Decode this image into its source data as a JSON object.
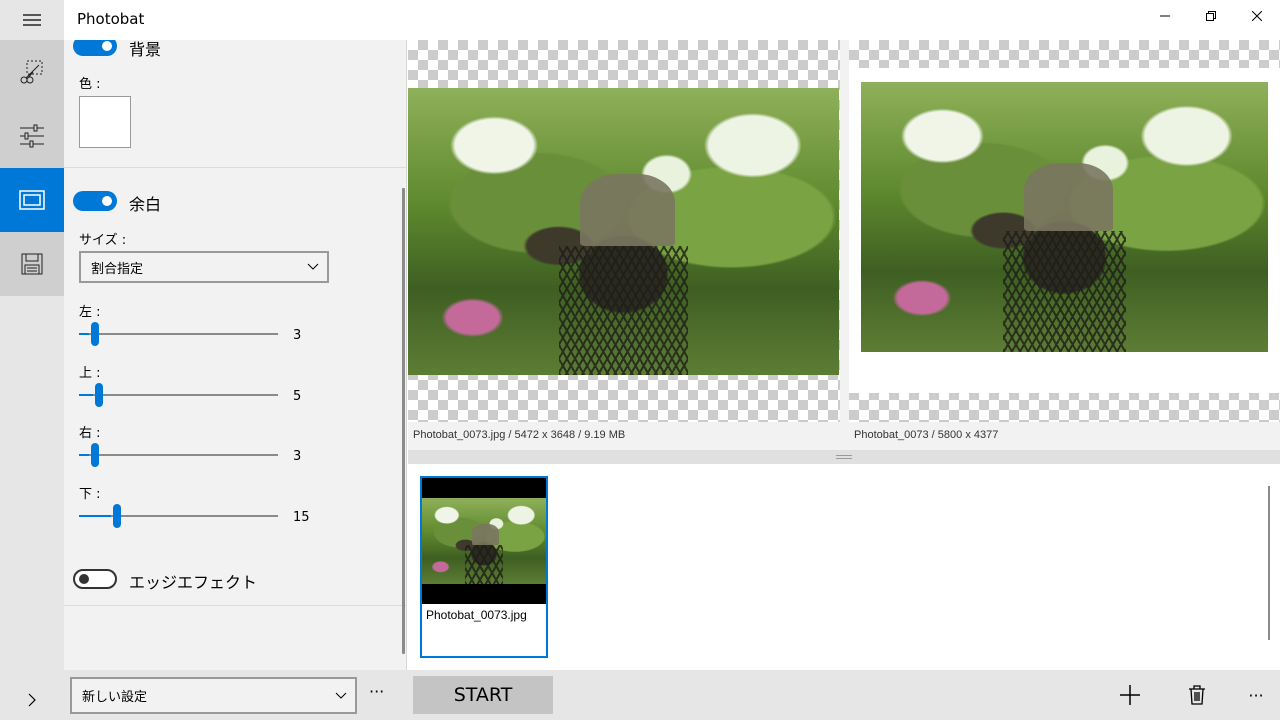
{
  "app": {
    "title": "Photobat"
  },
  "window": {
    "minimize": "—",
    "restore": "❐",
    "close": "✕"
  },
  "panel": {
    "background": {
      "label": "背景",
      "enabled": true,
      "color_label": "色 :",
      "color": "#ffffff"
    },
    "margin": {
      "label": "余白",
      "enabled": true,
      "size_label": "サイズ :",
      "size_value": "割合指定",
      "sliders": [
        {
          "label": "左 :",
          "value": "3",
          "fraction": 0.05
        },
        {
          "label": "上 :",
          "value": "5",
          "fraction": 0.07
        },
        {
          "label": "右 :",
          "value": "3",
          "fraction": 0.05
        },
        {
          "label": "下 :",
          "value": "15",
          "fraction": 0.16
        }
      ]
    },
    "edge_effect": {
      "label": "エッジエフェクト",
      "enabled": false
    },
    "preset": {
      "value": "新しい設定",
      "more": "···"
    }
  },
  "preview": {
    "source_caption": "Photobat_0073.jpg / 5472 x 3648 / 9.19 MB",
    "result_caption": "Photobat_0073 / 5800 x 4377"
  },
  "thumbnails": [
    {
      "label": "Photobat_0073.jpg"
    }
  ],
  "commands": {
    "start": "START",
    "add_icon": "plus-icon",
    "delete_icon": "trash-icon",
    "more": "···"
  },
  "colors": {
    "accent": "#0078d7",
    "rail_bg": "#e6e6e6",
    "panel_bg": "#f2f2f2"
  }
}
